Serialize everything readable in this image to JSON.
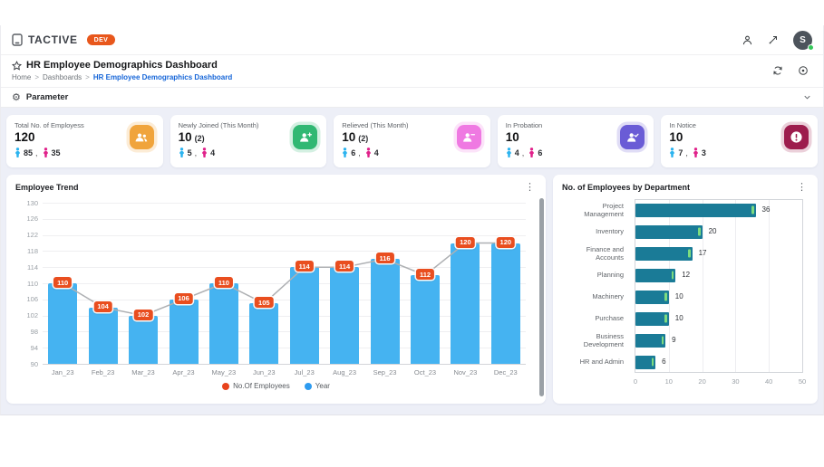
{
  "topbar": {
    "brand": "TACTIVE",
    "env_badge": "DEV",
    "avatar_initial": "S",
    "icons": [
      "user-icon",
      "expand-icon",
      "avatar"
    ]
  },
  "header": {
    "title": "HR Employee Demographics Dashboard",
    "breadcrumb": [
      {
        "label": "Home"
      },
      {
        "label": "Dashboards"
      },
      {
        "label": "HR Employee Demographics Dashboard"
      }
    ],
    "action_icons": [
      "refresh-icon",
      "target-icon"
    ]
  },
  "parameter": {
    "label": "Parameter",
    "icon": "gear-icon",
    "chevron": "chevron-down-icon"
  },
  "colors": {
    "male": "#2bb3ef",
    "female": "#e0218a",
    "background": "#edeff7",
    "breadcrumb_active": "#1565d8",
    "dev_badge": "#e8571c"
  },
  "kpis": [
    {
      "label": "Total No. of Employess",
      "value": "120",
      "sub": "",
      "male": "85",
      "female": "35",
      "icon": "users-icon",
      "color": "#f0a43c"
    },
    {
      "label": "Newly Joined (This Month)",
      "value": "10",
      "sub": "(2)",
      "male": "5",
      "female": "4",
      "icon": "user-plus-icon",
      "color": "#31b873"
    },
    {
      "label": "Relieved (This Month)",
      "value": "10",
      "sub": "(2)",
      "male": "6",
      "female": "4",
      "icon": "user-minus-icon",
      "color": "#ef79e2"
    },
    {
      "label": "In Probation",
      "value": "10",
      "sub": "",
      "male": "4",
      "female": "6",
      "icon": "user-check-icon",
      "color": "#6a5cd6"
    },
    {
      "label": "In Notice",
      "value": "10",
      "sub": "",
      "male": "7",
      "female": "3",
      "icon": "alert-icon",
      "color": "#9d1c4d"
    }
  ],
  "chart_data": [
    {
      "type": "bar",
      "subtype": "bar-with-line-and-labels",
      "title": "Employee Trend",
      "categories": [
        "Jan_23",
        "Feb_23",
        "Mar_23",
        "Apr_23",
        "May_23",
        "Jun_23",
        "Jul_23",
        "Aug_23",
        "Sep_23",
        "Oct_23",
        "Nov_23",
        "Dec_23"
      ],
      "values": [
        110,
        104,
        102,
        106,
        110,
        105,
        114,
        114,
        116,
        112,
        120,
        120
      ],
      "ylim": [
        90,
        130
      ],
      "ytick_step": 4,
      "grid": true,
      "bar_color": "#45b3f1",
      "line_color": "#aeb0b3",
      "label_badge_color": "#e94e1f",
      "legend_position": "bottom",
      "legend": [
        {
          "label": "No.Of Employees",
          "color": "#e8431c"
        },
        {
          "label": "Year",
          "color": "#2e9bf0"
        }
      ]
    },
    {
      "type": "bar",
      "orientation": "horizontal",
      "title": "No. of Employees by Department",
      "categories": [
        "Project Management",
        "Inventory",
        "Finance and Accounts",
        "Planning",
        "Machinery",
        "Purchase",
        "Business Development",
        "HR and Admin"
      ],
      "values": [
        36,
        20,
        17,
        12,
        10,
        10,
        9,
        6
      ],
      "xlim": [
        0,
        50
      ],
      "xticks": [
        0,
        10,
        20,
        30,
        40,
        50
      ],
      "grid": true,
      "bar_color": "#1a7b97",
      "bar_cap_color": "#7ddc7f"
    }
  ]
}
